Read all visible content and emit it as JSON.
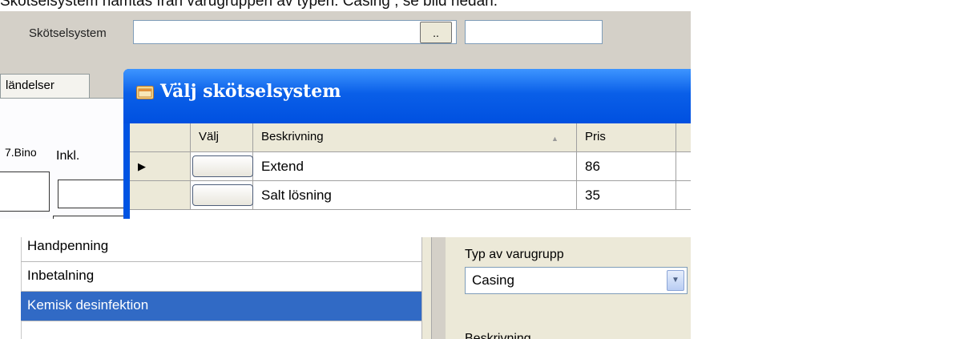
{
  "caption": "Skötselsystem hämtas från varugruppen av typen: Casing , se bild nedan.",
  "top": {
    "skotselsystem_label": "Skötselsystem",
    "browse_button": "..",
    "tab_label": "ländelser",
    "bino_label": "7.Bino",
    "inkl_label": "Inkl."
  },
  "dialog": {
    "title": "Välj skötselsystem",
    "columns": [
      "",
      "Välj",
      "Beskrivning",
      "Pris"
    ],
    "rows": [
      {
        "indicator": "▶",
        "description": "Extend",
        "price": "86"
      },
      {
        "indicator": "",
        "description": "Salt lösning",
        "price": "35"
      }
    ]
  },
  "bottom": {
    "list": [
      "Handpenning",
      "Inbetalning",
      "Kemisk desinfektion"
    ],
    "selected_index": 2,
    "typ_label": "Typ av varugrupp",
    "combo_value": "Casing",
    "cut_label": "Beskrivning"
  },
  "colors": {
    "window_gray": "#d4d0c8",
    "xp_blue_title": "#0054e3",
    "selection_blue": "#316ac5",
    "panel_beige": "#ece9d8"
  }
}
